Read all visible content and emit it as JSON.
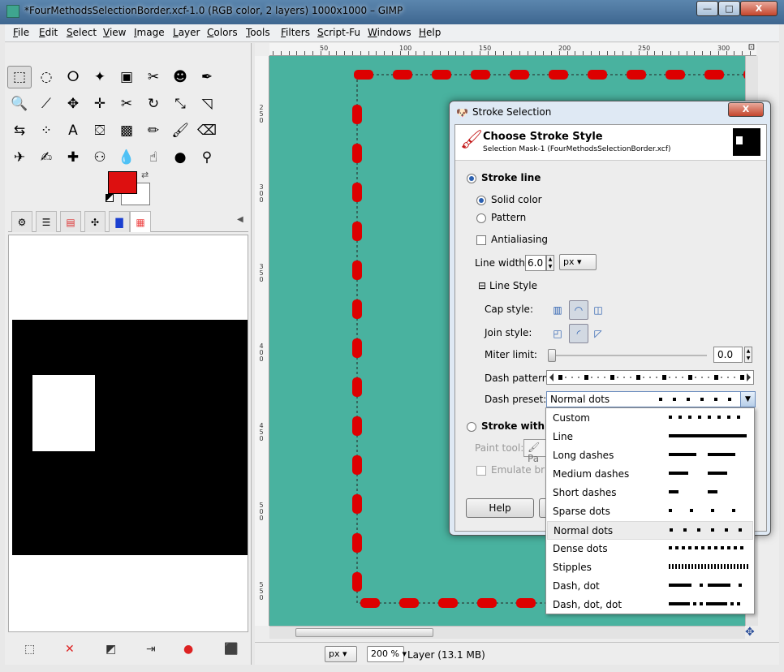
{
  "window": {
    "title": "*FourMethodsSelectionBorder.xcf-1.0 (RGB color, 2 layers) 1000x1000 – GIMP",
    "min_btn": "—",
    "max_btn": "□",
    "close_btn": "X"
  },
  "menu": [
    "File",
    "Edit",
    "Select",
    "View",
    "Image",
    "Layer",
    "Colors",
    "Tools",
    "Filters",
    "Script-Fu",
    "Windows",
    "Help"
  ],
  "toolbox": {
    "tools": [
      [
        "rect-select",
        "ellipse-select",
        "free-select",
        "fuzzy-select",
        "by-color-select",
        "scissors-select",
        "foreground-select",
        "paths"
      ],
      [
        "zoom",
        "measure",
        "move",
        "align",
        "crop",
        "rotate",
        "scale",
        "shear"
      ],
      [
        "flip",
        "cage",
        "text",
        "bucket-fill",
        "blend",
        "pencil",
        "paintbrush",
        "eraser"
      ],
      [
        "airbrush",
        "ink",
        "heal",
        "clone",
        "blur",
        "smudge",
        "dodge-burn",
        "color-picker"
      ]
    ],
    "tool_glyphs": [
      [
        "⬚",
        "◌",
        "ⵔ",
        "✦",
        "▣",
        "✂",
        "☻",
        "✒"
      ],
      [
        "🔍",
        "⟋",
        "✥",
        "✛",
        "✂",
        "↻",
        "⤡",
        "◹"
      ],
      [
        "⇆",
        "⁘",
        "A",
        "⛋",
        "▩",
        "✏",
        "🖌",
        "⌫"
      ],
      [
        "✈",
        "✍",
        "✚",
        "⚇",
        "💧",
        "☝",
        "●",
        "⚲"
      ]
    ],
    "fg_color": "#dd1010",
    "bg_color": "#ffffff"
  },
  "dock_bottom_icons": [
    "⬚",
    "✕",
    "◩",
    "⇥",
    "●",
    "⬛"
  ],
  "ruler": {
    "top_labels": [
      "50",
      "100",
      "150",
      "200",
      "250",
      "300"
    ],
    "left_labels": [
      "250",
      "300",
      "350",
      "400",
      "450",
      "500",
      "550"
    ]
  },
  "status": {
    "unit": "px",
    "zoom": "200 %",
    "text": "Layer (13.1 MB)"
  },
  "dialog": {
    "title": "Stroke Selection",
    "close": "X",
    "heading": "Choose Stroke Style",
    "subheading": "Selection Mask-1 (FourMethodsSelectionBorder.xcf)",
    "stroke_line": "Stroke line",
    "solid_color": "Solid color",
    "pattern": "Pattern",
    "antialiasing": "Antialiasing",
    "line_width_label": "Line width:",
    "line_width": "6.0",
    "line_width_unit": "px",
    "line_style": "Line Style",
    "cap_style": "Cap style:",
    "join_style": "Join style:",
    "miter_limit": "Miter limit:",
    "miter_value": "0.0",
    "dash_pattern": "Dash pattern:",
    "dash_preset_label": "Dash preset:",
    "dash_preset_value": "Normal dots",
    "stroke_with": "Stroke with a p",
    "paint_tool": "Paint tool:",
    "paint_tool_value": "Pa",
    "emulate": "Emulate brus",
    "help": "Help"
  },
  "presets": [
    "Custom",
    "Line",
    "Long dashes",
    "Medium dashes",
    "Short dashes",
    "Sparse dots",
    "Normal dots",
    "Dense dots",
    "Stipples",
    "Dash, dot",
    "Dash, dot, dot"
  ],
  "selected_preset": "Normal dots",
  "colors": {
    "canvas": "#49b29f",
    "stroke": "#dd0000",
    "accent": "#2a5fb0"
  }
}
